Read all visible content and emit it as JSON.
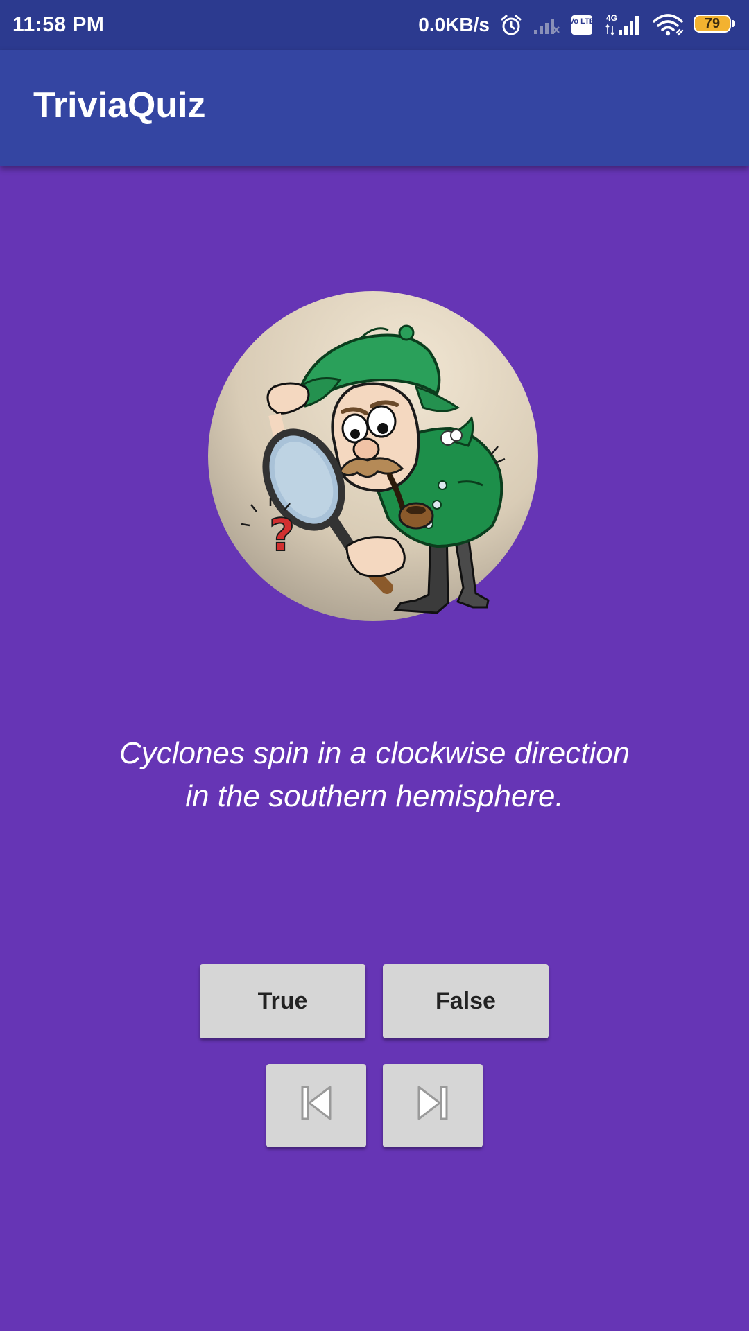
{
  "status_bar": {
    "time": "11:58 PM",
    "net_speed": "0.0KB/s",
    "volte_label": "Vo LTE",
    "network_label": "4G",
    "battery_level": "79",
    "icons": [
      "alarm-icon",
      "signal-weak-icon",
      "volte-icon",
      "signal-4g-icon",
      "wifi-icon",
      "battery-icon"
    ]
  },
  "app_bar": {
    "title": "TriviaQuiz"
  },
  "question": {
    "text_line1": "Cyclones spin in a clockwise direction",
    "text_line2": "in the southern hemisphere.",
    "illustration": "detective-with-magnifying-glass"
  },
  "answers": {
    "true_label": "True",
    "false_label": "False"
  },
  "navigation": {
    "prev_icon": "skip-previous-icon",
    "next_icon": "skip-next-icon"
  },
  "colors": {
    "background": "#6635b5",
    "app_bar": "#3445a2",
    "status_bar": "#2c3a8f",
    "button": "#d6d6d6",
    "battery": "#f3b230"
  }
}
